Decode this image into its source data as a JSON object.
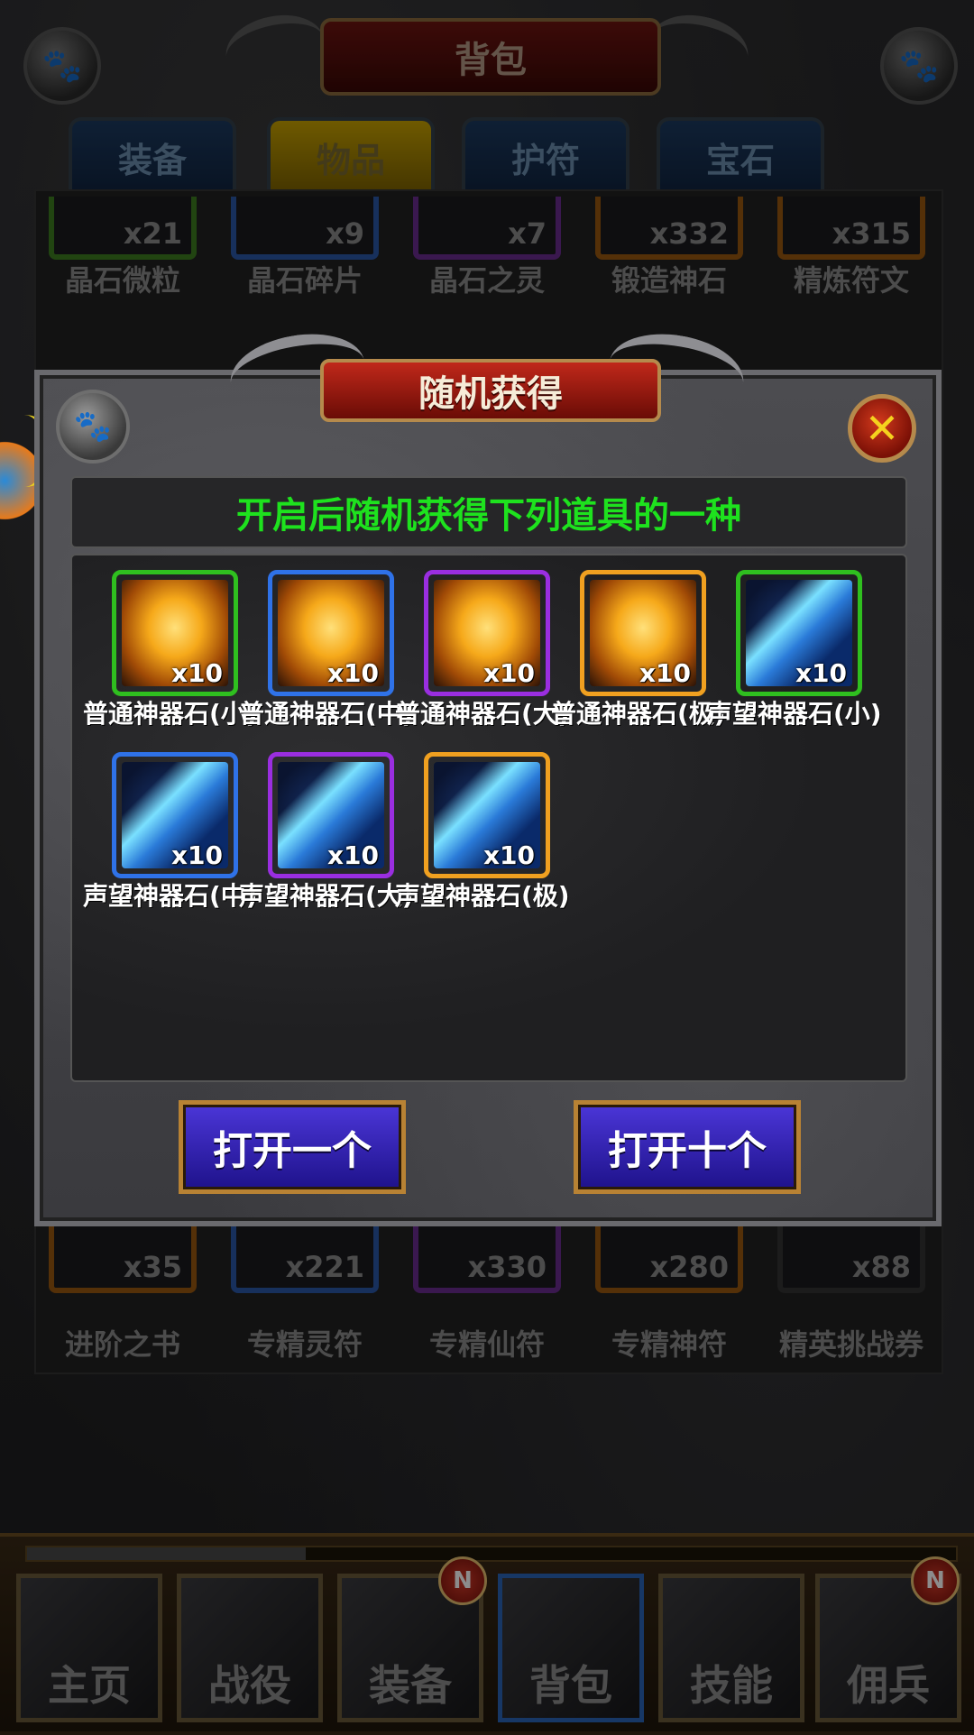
{
  "header": {
    "title": "背包"
  },
  "tabs": [
    {
      "label": "装备",
      "active": false
    },
    {
      "label": "物品",
      "active": true
    },
    {
      "label": "护符",
      "active": false
    },
    {
      "label": "宝石",
      "active": false
    }
  ],
  "bag_top_row": [
    {
      "name": "晶石微粒",
      "count": "x21",
      "rarity": "green"
    },
    {
      "name": "晶石碎片",
      "count": "x9",
      "rarity": "blue"
    },
    {
      "name": "晶石之灵",
      "count": "x7",
      "rarity": "purple"
    },
    {
      "name": "锻造神石",
      "count": "x332",
      "rarity": "orange"
    },
    {
      "name": "精炼符文",
      "count": "x315",
      "rarity": "orange"
    }
  ],
  "bag_bottom_row": [
    {
      "name": "进阶之书",
      "count": "x35",
      "rarity": "orange"
    },
    {
      "name": "专精灵符",
      "count": "x221",
      "rarity": "blue"
    },
    {
      "name": "专精仙符",
      "count": "x330",
      "rarity": "purple"
    },
    {
      "name": "专精神符",
      "count": "x280",
      "rarity": "orange"
    },
    {
      "name": "精英挑战券",
      "count": "x88",
      "rarity": "none"
    }
  ],
  "modal": {
    "title": "随机获得",
    "close_icon": "close-x-icon",
    "instruction": "开启后随机获得下列道具的一种",
    "rewards": [
      {
        "name": "普通神器石(小)",
        "count": "x10",
        "rarity": "green",
        "art": "gold-stone"
      },
      {
        "name": "普通神器石(中)",
        "count": "x10",
        "rarity": "blue",
        "art": "gold-stone"
      },
      {
        "name": "普通神器石(大)",
        "count": "x10",
        "rarity": "purple",
        "art": "gold-stone"
      },
      {
        "name": "普通神器石(极)",
        "count": "x10",
        "rarity": "orange",
        "art": "gold-stone"
      },
      {
        "name": "声望神器石(小)",
        "count": "x10",
        "rarity": "green",
        "art": "blue-crystal"
      },
      {
        "name": "声望神器石(中)",
        "count": "x10",
        "rarity": "blue",
        "art": "blue-crystal"
      },
      {
        "name": "声望神器石(大)",
        "count": "x10",
        "rarity": "purple",
        "art": "blue-crystal"
      },
      {
        "name": "声望神器石(极)",
        "count": "x10",
        "rarity": "orange",
        "art": "blue-crystal"
      }
    ],
    "open_one_label": "打开一个",
    "open_ten_label": "打开十个"
  },
  "bottom_nav": [
    {
      "label": "主页",
      "badge": ""
    },
    {
      "label": "战役",
      "badge": ""
    },
    {
      "label": "装备",
      "badge": "N"
    },
    {
      "label": "背包",
      "badge": "",
      "active": true
    },
    {
      "label": "技能",
      "badge": ""
    },
    {
      "label": "佣兵",
      "badge": "N"
    }
  ],
  "exp_progress": 0.3,
  "colors": {
    "green": "#2fbf1f",
    "blue": "#2f72e8",
    "purple": "#9a2ee0",
    "orange": "#f0a020",
    "instruction_text": "#1ee21e",
    "button_fill": "#3a28c8"
  }
}
